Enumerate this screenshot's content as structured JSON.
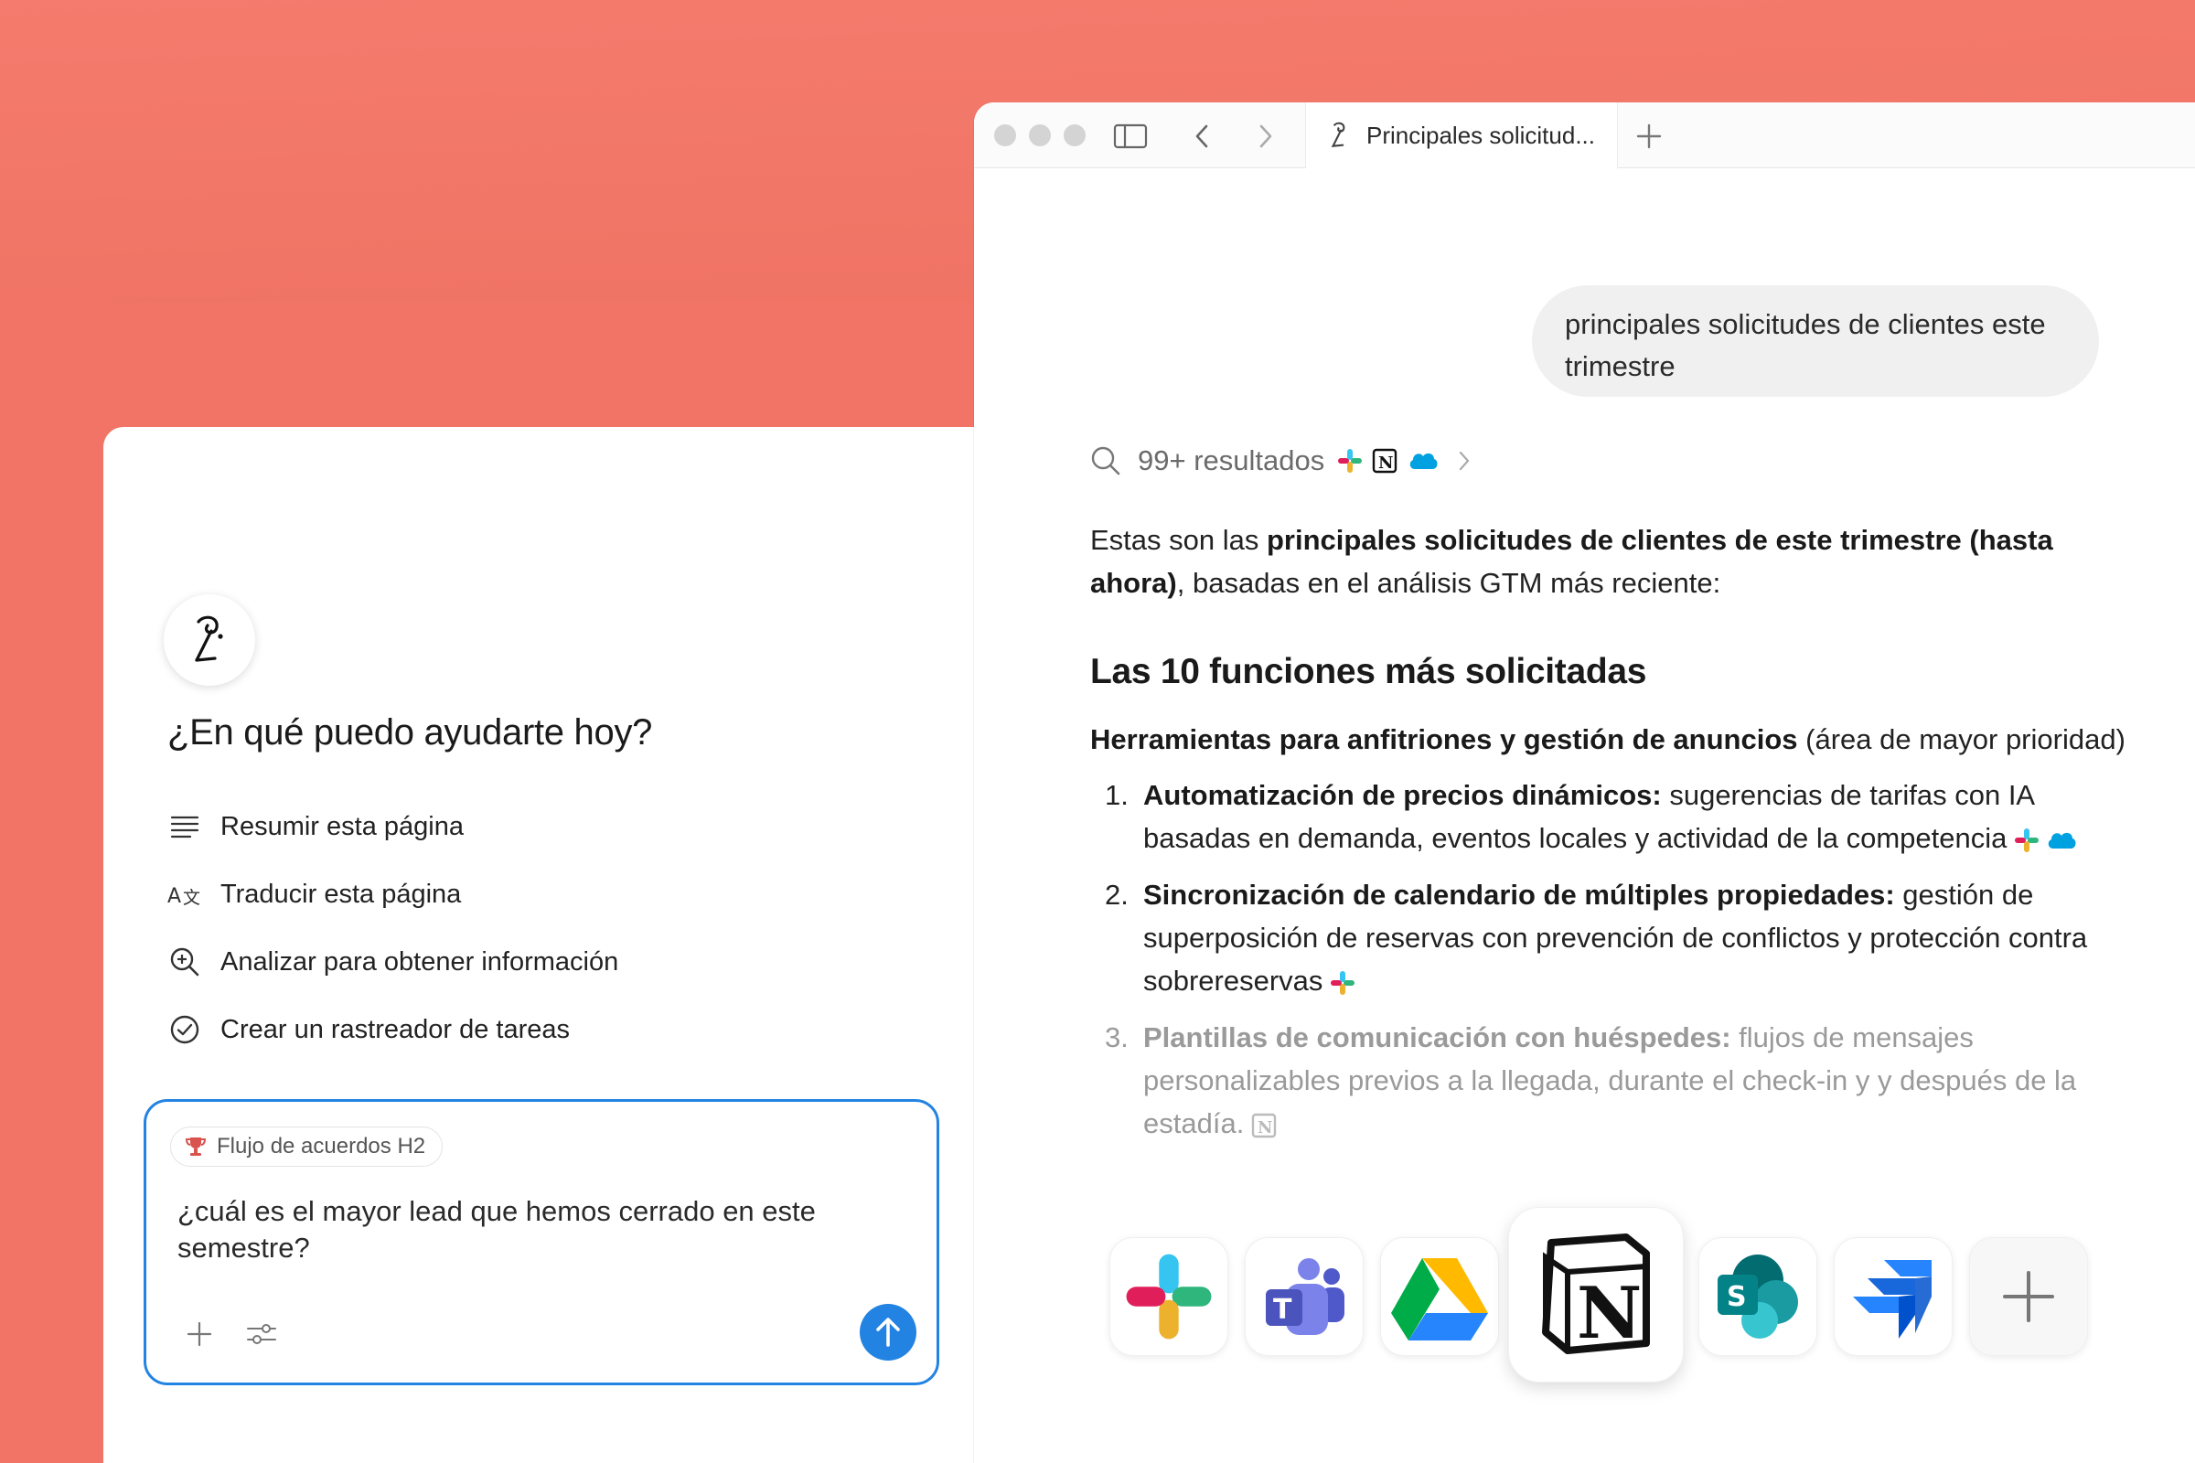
{
  "left": {
    "greeting": "¿En qué puedo ayudarte hoy?",
    "actions": [
      {
        "label": "Resumir esta página",
        "icon": "lines-icon"
      },
      {
        "label": "Traducir esta página",
        "icon": "translate-icon"
      },
      {
        "label": "Analizar para obtener información",
        "icon": "zoom-in-icon"
      },
      {
        "label": "Crear un rastreador de tareas",
        "icon": "check-circle-icon"
      }
    ],
    "composer": {
      "context_chip": "Flujo de acuerdos H2",
      "prompt": "¿cuál es el mayor lead que hemos cerrado en este semestre?",
      "send_color": "#2383e2"
    }
  },
  "browser": {
    "tab_title": "Principales solicitud...",
    "user_message": "principales solicitudes de clientes este trimestre",
    "results_label": "99+ resultados",
    "answer": {
      "intro_prefix": "Estas son las ",
      "intro_bold": "principales solicitudes de clientes de este trimestre (hasta ahora)",
      "intro_suffix": ", basadas en el análisis GTM más reciente:",
      "heading": "Las 10 funciones más solicitadas",
      "category_bold": "Herramientas para anfitriones y gestión de anuncios",
      "category_rest": " (área de mayor prioridad)",
      "items": [
        {
          "num": "1.",
          "title": "Automatización de precios dinámicos:",
          "text": " sugerencias de tarifas con IA basadas en demanda, eventos locales y actividad de la competencia"
        },
        {
          "num": "2.",
          "title": "Sincronización de calendario de múltiples propiedades:",
          "text": " gestión de superposición de reservas con prevención de conflictos y protección contra sobrereservas"
        },
        {
          "num": "3.",
          "title": "Plantillas de comunicación con huéspedes:",
          "text": " flujos de mensajes personalizables previos a la llegada, durante el check-in y y después de la estadía."
        }
      ]
    },
    "apps": [
      "slack-icon",
      "teams-icon",
      "google-drive-icon",
      "notion-icon",
      "sharepoint-icon",
      "jira-icon",
      "add-integration-icon"
    ]
  },
  "colors": {
    "background": "#f3786a",
    "accent": "#2383e2"
  }
}
